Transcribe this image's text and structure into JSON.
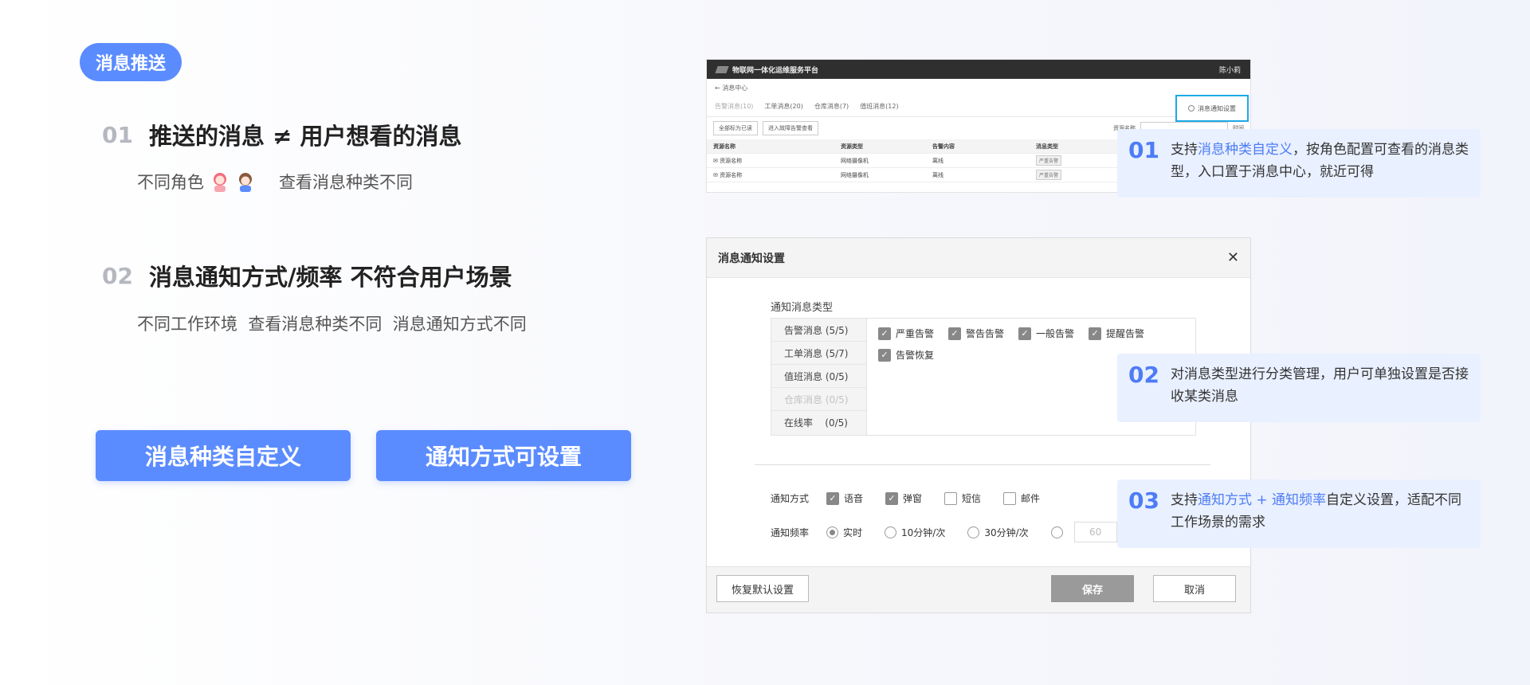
{
  "tag": "消息推送",
  "points": [
    {
      "num": "01",
      "title": "推送的消息 ≠ 用户想看的消息",
      "sub_a": "不同角色",
      "sub_b": "查看消息种类不同"
    },
    {
      "num": "02",
      "title": "消息通知方式/频率 不符合用户场景",
      "sub": "不同工作环境  查看消息种类不同  消息通知方式不同"
    }
  ],
  "buttons": [
    "消息种类自定义",
    "通知方式可设置"
  ],
  "shot1": {
    "platform": "物联网一体化运维服务平台",
    "user": "陈小莉",
    "breadcrumb": "← 消息中心",
    "tabs": [
      "告警消息(10)",
      "工单消息(20)",
      "仓库消息(7)",
      "值班消息(12)"
    ],
    "setting": "消息通知设置",
    "tool_btns": [
      "全部标为已读",
      "进入故障告警查看"
    ],
    "filter_label": "资源名称",
    "filter_label2": "时间",
    "headers": [
      "资源名称",
      "资源类型",
      "告警内容",
      "消息类型"
    ],
    "rows": [
      [
        "资源名称",
        "网络摄像机",
        "离线",
        "严重告警"
      ],
      [
        "资源名称",
        "网络摄像机",
        "离线",
        "严重告警"
      ]
    ]
  },
  "dialog": {
    "title": "消息通知设置",
    "close": "✕",
    "section": "通知消息类型",
    "categories": [
      {
        "label": "告警消息 (5/5)",
        "dim": false
      },
      {
        "label": "工单消息 (5/7)",
        "dim": false
      },
      {
        "label": "值班消息 (0/5)",
        "dim": false
      },
      {
        "label": "仓库消息 (0/5)",
        "dim": true
      },
      {
        "label": "在线率    (0/5)",
        "dim": false
      }
    ],
    "checks": [
      "严重告警",
      "警告告警",
      "一般告警",
      "提醒告警",
      "告警恢复"
    ],
    "method_label": "通知方式",
    "methods": [
      {
        "label": "语音",
        "on": true
      },
      {
        "label": "弹窗",
        "on": true
      },
      {
        "label": "短信",
        "on": false
      },
      {
        "label": "邮件",
        "on": false
      }
    ],
    "freq_label": "通知频率",
    "freqs": [
      {
        "label": "实时",
        "on": true
      },
      {
        "label": "10分钟/次",
        "on": false
      },
      {
        "label": "30分钟/次",
        "on": false
      }
    ],
    "freq_value": "60",
    "reset": "恢复默认设置",
    "save": "保存",
    "cancel": "取消"
  },
  "callouts": [
    {
      "num": "01",
      "pre": "支持",
      "hl": "消息种类自定义",
      "post": "，按角色配置可查看的消息类型，入口置于消息中心，就近可得"
    },
    {
      "num": "02",
      "pre": "对消息类型进行分类管理，用户可单独设置是否接收某类消息",
      "hl": "",
      "post": ""
    },
    {
      "num": "03",
      "pre": "支持",
      "hl": "通知方式 + 通知频率",
      "post": "自定义设置，适配不同工作场景的需求"
    }
  ],
  "colors": {
    "accent": "#5b8cff",
    "callout_bg": "#e9f0ff",
    "highlight_border": "#1ea9e6"
  }
}
